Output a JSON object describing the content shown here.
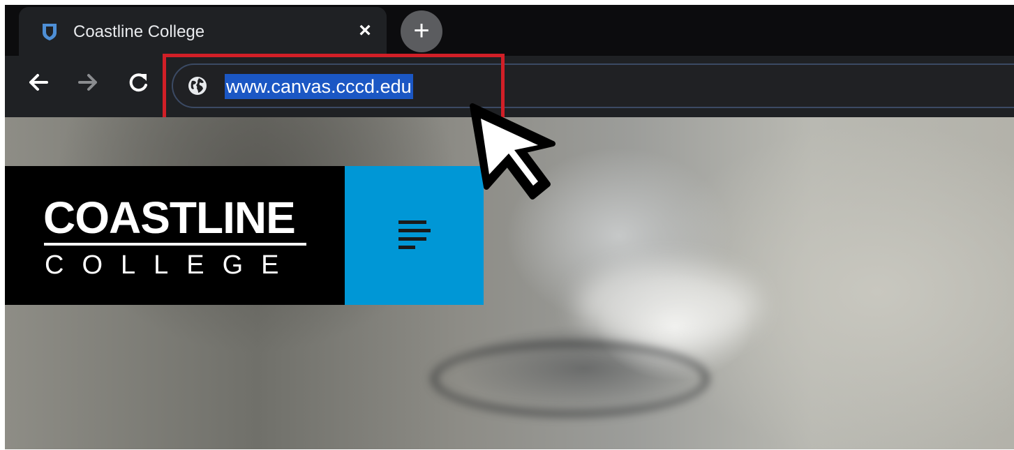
{
  "browser": {
    "tab": {
      "title": "Coastline College",
      "favicon": "shield-icon",
      "close_glyph": "×"
    },
    "new_tab_glyph": "+",
    "toolbar": {
      "back_icon": "arrow-left-icon",
      "forward_icon": "arrow-right-icon",
      "reload_icon": "reload-icon"
    },
    "omnibox": {
      "site_icon": "globe-icon",
      "url": "www.canvas.cccd.edu",
      "url_selected": true
    }
  },
  "page": {
    "logo": {
      "line1": "COASTLINE",
      "line2": "COLLEGE"
    },
    "menu_icon": "hamburger-menu-icon"
  },
  "annotation": {
    "highlight_color": "#d11f27",
    "pointer": "mouse-pointer-icon"
  },
  "colors": {
    "tab_strip": "#0c0c0e",
    "toolbar": "#1f2124",
    "url_selection": "#1b57c4",
    "logo_background": "#000000",
    "menu_background": "#0097d6",
    "favicon": "#4e8fd6"
  }
}
